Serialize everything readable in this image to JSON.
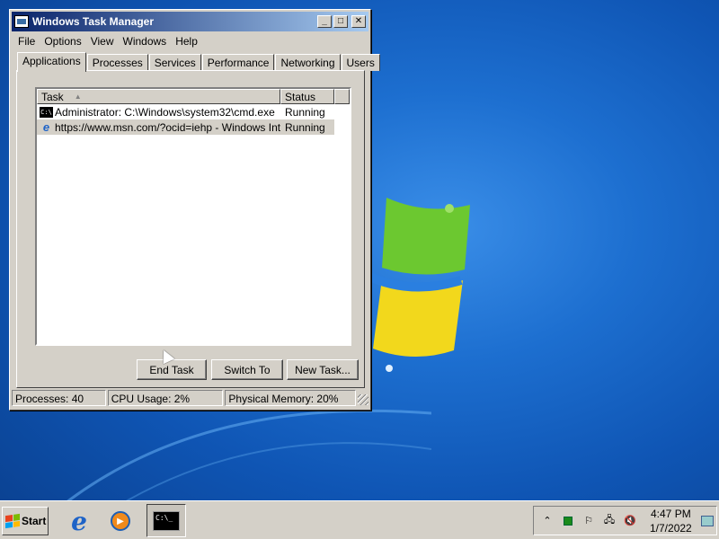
{
  "window": {
    "title": "Windows Task Manager",
    "buttons": {
      "minimize": "_",
      "maximize": "□",
      "close": "✕"
    }
  },
  "menu": [
    "File",
    "Options",
    "View",
    "Windows",
    "Help"
  ],
  "tabs": [
    "Applications",
    "Processes",
    "Services",
    "Performance",
    "Networking",
    "Users"
  ],
  "table": {
    "headers": {
      "task": "Task",
      "status": "Status"
    },
    "rows": [
      {
        "icon": "cmd-icon",
        "task": "Administrator: C:\\Windows\\system32\\cmd.exe",
        "status": "Running"
      },
      {
        "icon": "ie-icon",
        "task": "https://www.msn.com/?ocid=iehp - Windows Int...",
        "status": "Running"
      }
    ]
  },
  "actions": {
    "end_task": "End Task",
    "switch_to": "Switch To",
    "new_task": "New Task..."
  },
  "status": {
    "processes": "Processes: 40",
    "cpu": "CPU Usage: 2%",
    "memory": "Physical Memory: 20%"
  },
  "taskbar": {
    "start": "Start",
    "cmd_label": "C:\\_",
    "time": "4:47 PM",
    "date": "1/7/2022"
  },
  "colors": {
    "desktop": "#1d6fd0",
    "titlebar": "#0a246a",
    "chrome": "#d4d0c8"
  }
}
